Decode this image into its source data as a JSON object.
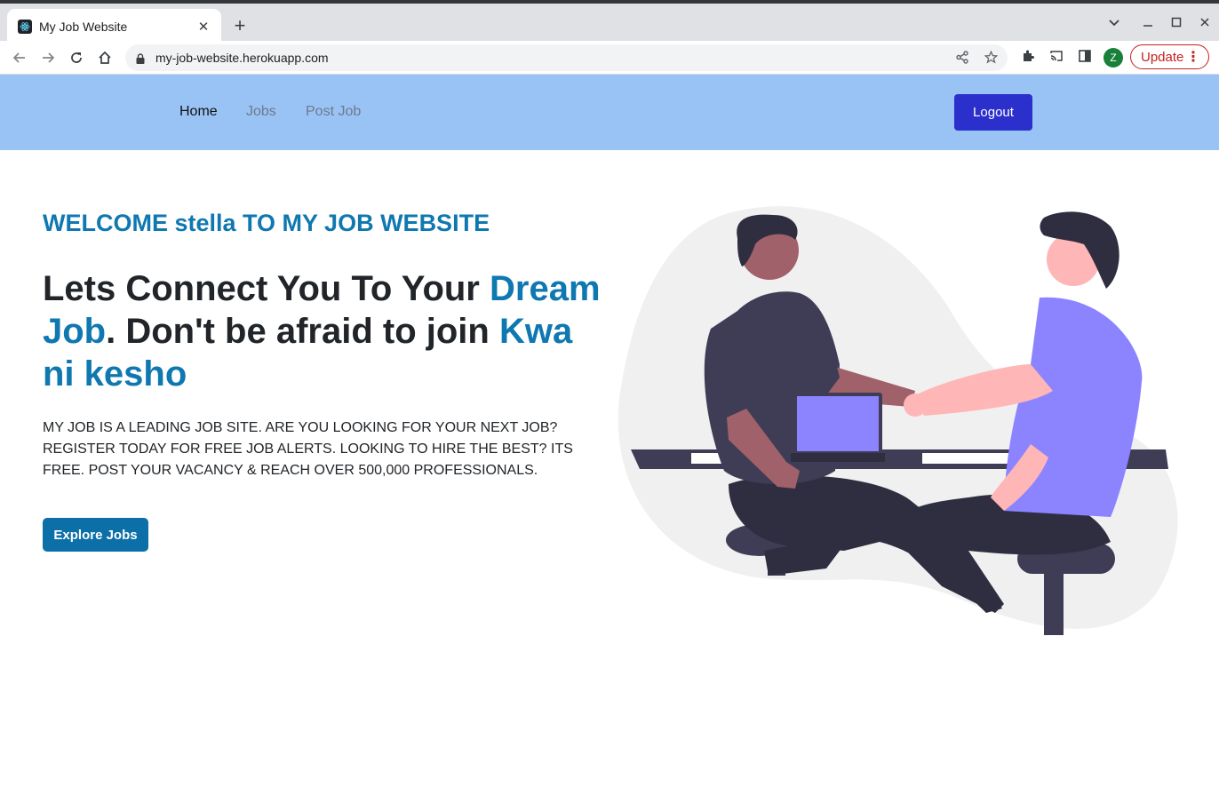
{
  "browser": {
    "tab_title": "My Job Website",
    "tab_close": "✕",
    "new_tab": "+",
    "url": "my-job-website.herokuapp.com",
    "avatar_letter": "Z",
    "update_label": "Update"
  },
  "nav": {
    "links": [
      {
        "label": "Home",
        "active": true
      },
      {
        "label": "Jobs",
        "active": false
      },
      {
        "label": "Post Job",
        "active": false
      }
    ],
    "logout_label": "Logout"
  },
  "hero": {
    "welcome": "WELCOME stella TO MY JOB WEBSITE",
    "headline_part1": "Lets Connect You To Your ",
    "headline_highlight1": "Dream Job",
    "headline_part2": ". Don't be afraid to join ",
    "headline_highlight2": "Kwa ni kesho",
    "intro": "MY JOB IS A LEADING JOB SITE. ARE YOU LOOKING FOR YOUR NEXT JOB? REGISTER TODAY FOR FREE JOB ALERTS. LOOKING TO HIRE THE BEST? ITS FREE. POST YOUR VACANCY & REACH OVER 500,000 PROFESSIONALS.",
    "cta_label": "Explore Jobs"
  },
  "colors": {
    "navbar_bg": "#99c3f4",
    "accent": "#1078b0",
    "logout_bg": "#2b2fcb",
    "cta_bg": "#0d6fa8"
  }
}
